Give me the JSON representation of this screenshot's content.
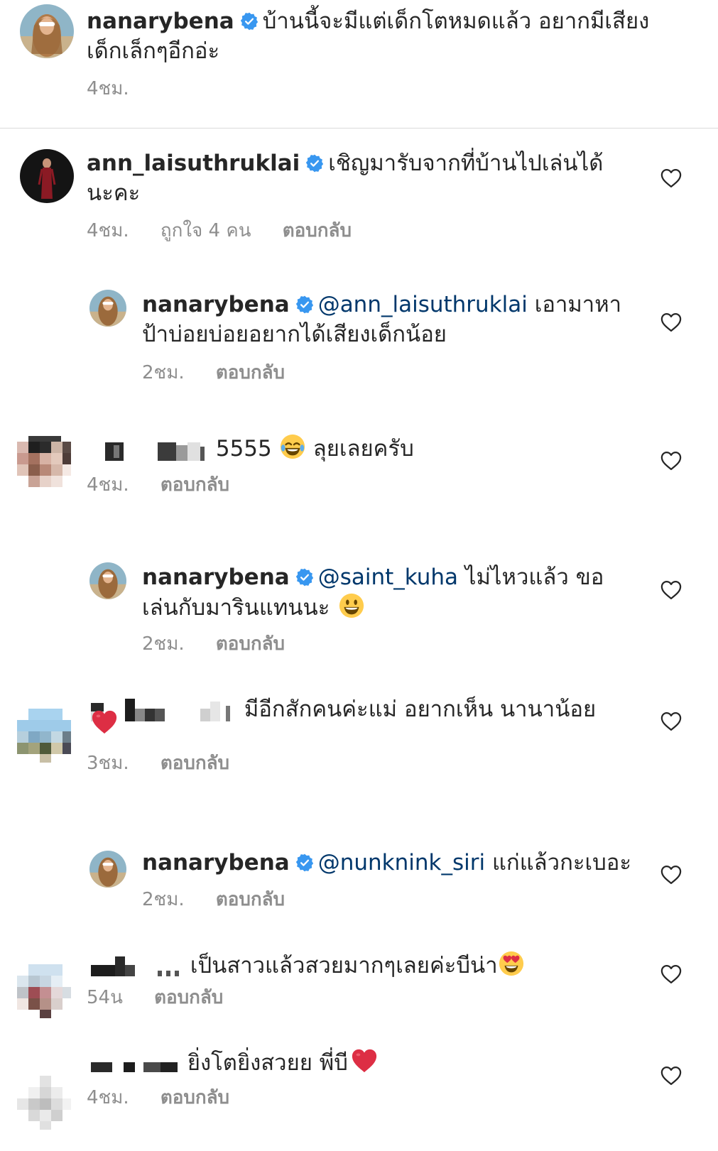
{
  "header_comment": {
    "username": "nanarybena",
    "text": "บ้านนี้จะมีแต่เด็กโตหมดแล้ว อยากมีเสียงเด็กเล็กๆอีกอ่ะ",
    "time": "4ชม."
  },
  "comments": [
    {
      "username": "ann_laisuthruklai",
      "text": "เชิญมารับจากที่บ้านไปเล่นได้นะคะ",
      "time": "4ชม.",
      "likes": "ถูกใจ 4 คน",
      "reply": "ตอบกลับ"
    },
    {
      "username": "nanarybena",
      "mention": "@ann_laisuthruklai",
      "text": "เอามาหาป้าบ่อยบ่อยอยากได้เสียงเด็กน้อย",
      "time": "2ชม.",
      "reply": "ตอบกลับ"
    },
    {
      "text": "5555",
      "text2": "ลุยเลยครับ",
      "time": "4ชม.",
      "reply": "ตอบกลับ"
    },
    {
      "username": "nanarybena",
      "mention": "@saint_kuha",
      "text": "ไม่ไหวแล้ว ขอเล่นกับมารินแทนนะ",
      "time": "2ชม.",
      "reply": "ตอบกลับ"
    },
    {
      "text": "มีอีกสักคนค่ะแม่ อยากเห็น นานาน้อย",
      "time": "3ชม.",
      "reply": "ตอบกลับ"
    },
    {
      "username": "nanarybena",
      "mention": "@nunknink_siri",
      "text": "แก่แล้วกะเบอะ",
      "time": "2ชม.",
      "reply": "ตอบกลับ"
    },
    {
      "text": "เป็นสาวแล้วสวยมากๆเลยค่ะบีน่า",
      "time": "54น",
      "reply": "ตอบกลับ"
    },
    {
      "text": "ยิ่งโตยิ่งสวยย พี่บี",
      "time": "4ชม.",
      "reply": "ตอบกลับ"
    }
  ],
  "icons": {
    "verified": "verified-badge-icon",
    "heart": "heart-outline-icon"
  },
  "colors": {
    "text": "#262626",
    "meta": "#8e8e8e",
    "mention": "#00376b",
    "verified": "#3897f0",
    "divider": "#dbdbdb"
  }
}
